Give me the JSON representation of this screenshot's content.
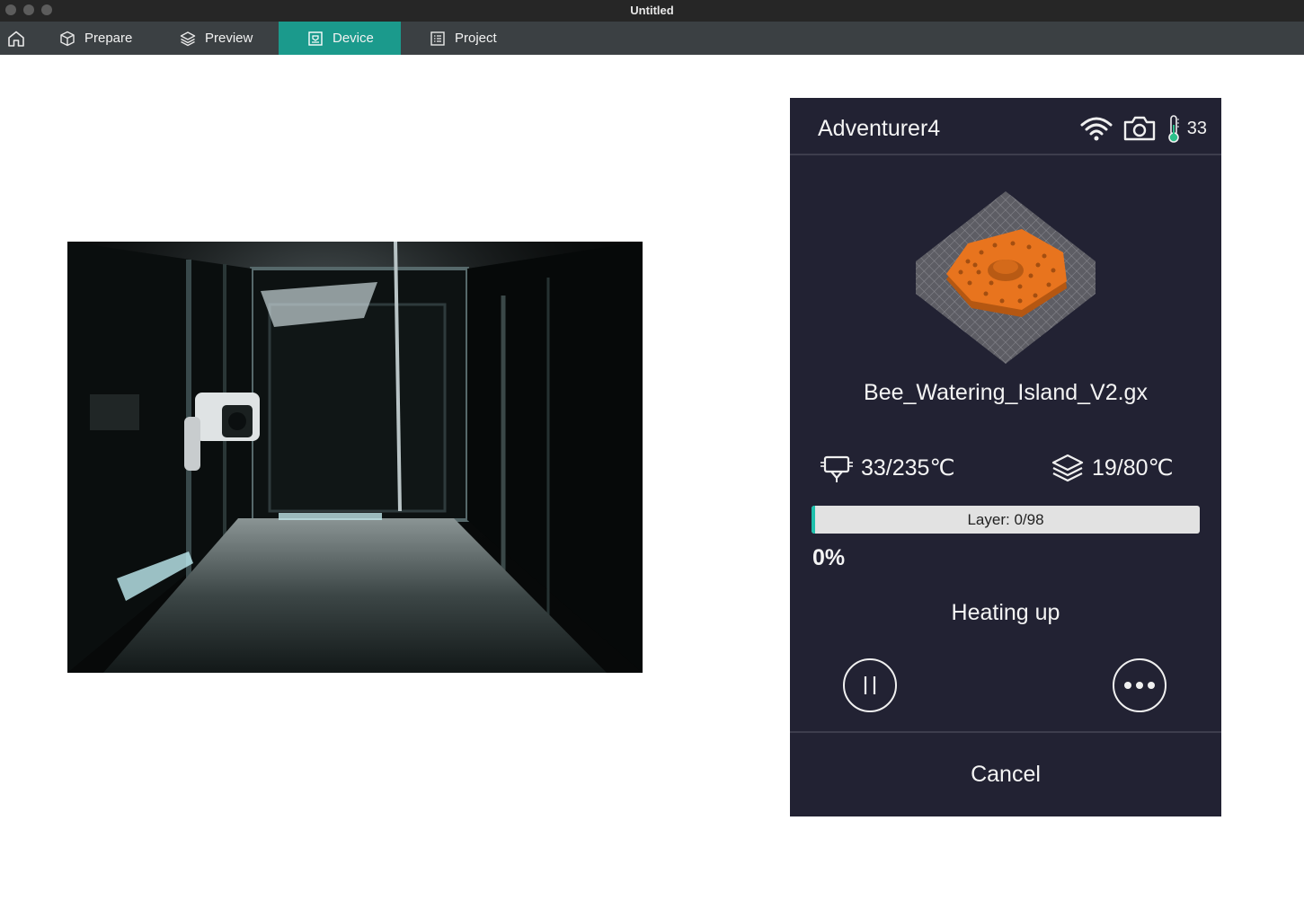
{
  "window": {
    "title": "Untitled"
  },
  "tabs": [
    {
      "label": "Prepare",
      "icon": "cube-icon"
    },
    {
      "label": "Preview",
      "icon": "layers-icon"
    },
    {
      "label": "Device",
      "icon": "device-icon",
      "active": true
    },
    {
      "label": "Project",
      "icon": "list-icon"
    }
  ],
  "camera": {
    "icon": "camera-feed"
  },
  "printer": {
    "name": "Adventurer4",
    "chamber_temp": "33",
    "file_name": "Bee_Watering_Island_V2.gx",
    "nozzle_temp": "33/235℃",
    "bed_temp": "19/80℃",
    "layer_label": "Layer: 0/98",
    "progress_fraction": 0.0,
    "percent": "0%",
    "status": "Heating up",
    "cancel_label": "Cancel"
  },
  "colors": {
    "accent": "#1b9a8c",
    "panel_bg": "#222233",
    "tabbar_bg": "#3b4043",
    "model_orange": "#e8741e",
    "progress_fill": "#1ec0ac"
  }
}
